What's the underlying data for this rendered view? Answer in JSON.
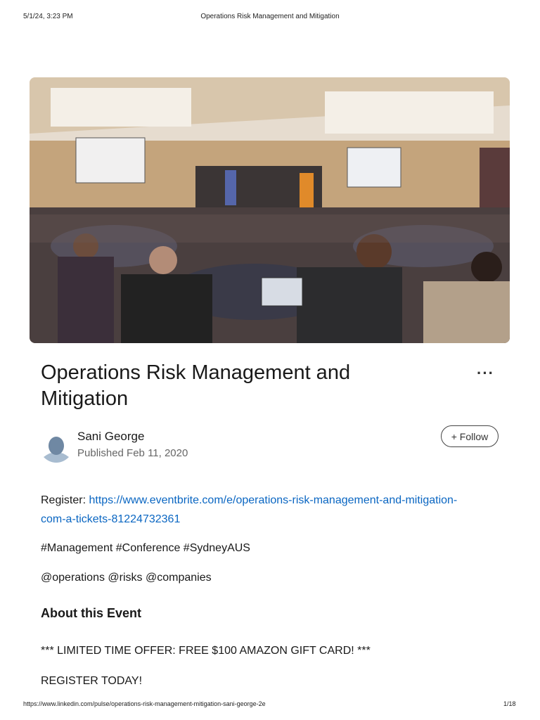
{
  "print_header": {
    "datetime": "5/1/24, 3:23 PM",
    "doc_title": "Operations Risk Management and Mitigation"
  },
  "article": {
    "title": "Operations Risk Management and Mitigation",
    "more_icon": "ellipsis-icon",
    "more_label": "···",
    "author": "Sani George",
    "published": "Published Feb 11, 2020",
    "follow_label": "+ Follow",
    "register_label": "Register: ",
    "register_link": "https://www.eventbrite.com/e/operations-risk-management-and-mitigation-com-a-tickets-81224732361",
    "hashtags": "#Management #Conference #SydneyAUS",
    "mentions": "@operations @risks @companies",
    "section_heading": "About this Event",
    "offer": "*** LIMITED TIME OFFER: FREE $100 AMAZON GIFT CARD! ***",
    "cta": "REGISTER TODAY!"
  },
  "print_footer": {
    "url": "https://www.linkedin.com/pulse/operations-risk-management-mitigation-sani-george-2e",
    "page": "1/18"
  },
  "colors": {
    "link": "#0a66c2"
  }
}
